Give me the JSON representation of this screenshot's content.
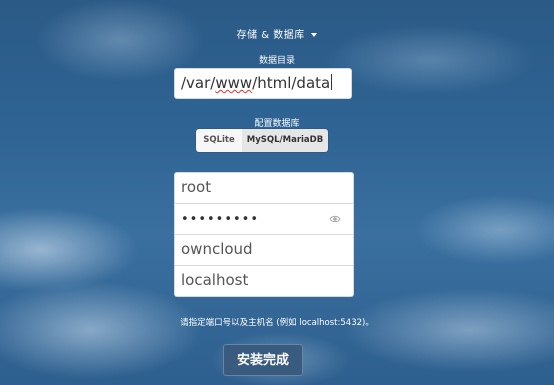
{
  "storage_toggle": {
    "label": "存储 & 数据库"
  },
  "data_dir": {
    "label": "数据目录",
    "value_prefix": "/var/",
    "value_misspelled": "www",
    "value_suffix": "/html/data"
  },
  "db_config": {
    "label": "配置数据库",
    "options": [
      {
        "label": "SQLite",
        "selected": false
      },
      {
        "label": "MySQL/MariaDB",
        "selected": true
      }
    ]
  },
  "fields": {
    "db_user": "root",
    "db_password_mask": "•••••••••",
    "db_name": "owncloud",
    "db_host": "localhost"
  },
  "hint": "请指定端口号以及主机名 (例如 localhost:5432)。",
  "submit_label": "安装完成",
  "icons": {
    "caret": "caret-down-icon",
    "password_toggle": "eye-icon"
  }
}
